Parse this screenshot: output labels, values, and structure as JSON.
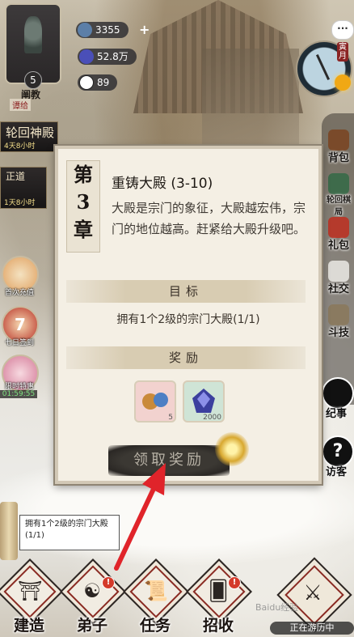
{
  "player": {
    "level": "5",
    "faction": "阐教",
    "faction_sub": "谭给"
  },
  "currencies": [
    {
      "name": "jade-coin",
      "value": "3355",
      "color": "#5c7fa8"
    },
    {
      "name": "spirit-stone",
      "value": "52.8万",
      "color": "#4a4fb8"
    },
    {
      "name": "yin-yang",
      "value": "89",
      "color": "#ffffff"
    }
  ],
  "plus_label": "+",
  "chat_label": "···",
  "calendar": {
    "month": "寅月"
  },
  "left_events": {
    "reincarnation": {
      "title": "轮回神殿",
      "timer": "4天8小时"
    },
    "orthodox": {
      "title": "正道",
      "timer": "1天8小时"
    },
    "first_charge": {
      "label": "首次充值"
    },
    "sign_in": {
      "label": "七日签到",
      "day": "7"
    },
    "limited": {
      "label": "限时特惠",
      "timer": "01:59:55"
    }
  },
  "right_menu": [
    {
      "id": "bag",
      "label": "背包"
    },
    {
      "id": "chess",
      "label": "轮回棋局"
    },
    {
      "id": "gift",
      "label": "礼包"
    },
    {
      "id": "social",
      "label": "社交"
    },
    {
      "id": "duel",
      "label": "斗技"
    }
  ],
  "right_big": [
    {
      "id": "events",
      "label": "纪事"
    },
    {
      "id": "guest",
      "label": "访客"
    }
  ],
  "dialog": {
    "chapter": [
      "第",
      "3",
      "章"
    ],
    "title": "重铸大殿 (3-10)",
    "description": "大殿是宗门的象征，大殿越宏伟，宗门的地位越高。赶紧给大殿升级吧。",
    "goal_header": "目标",
    "goal_text": "拥有1个2级的宗门大殿(1/1)",
    "reward_header": "奖励",
    "rewards": [
      {
        "name": "beast-egg",
        "count": "5",
        "color": "#f2d2cf"
      },
      {
        "name": "spirit-crystal",
        "count": "2000",
        "color": "#cfe4d6"
      }
    ],
    "claim_label": "领取奖励"
  },
  "task_tip": {
    "text": "拥有1个2级的宗门大殿(1/1)"
  },
  "bottom_nav": [
    {
      "id": "build",
      "label": "建造",
      "icon": "⛩"
    },
    {
      "id": "disciples",
      "label": "弟子",
      "icon": "☯",
      "badge": "!"
    },
    {
      "id": "tasks",
      "label": "任务",
      "icon": "📜"
    },
    {
      "id": "recruit",
      "label": "招收",
      "icon": "🂠",
      "badge": "!"
    }
  ],
  "travel": {
    "label": "正在游历中",
    "icon": "⚔"
  },
  "watermark": "Baidu经验"
}
